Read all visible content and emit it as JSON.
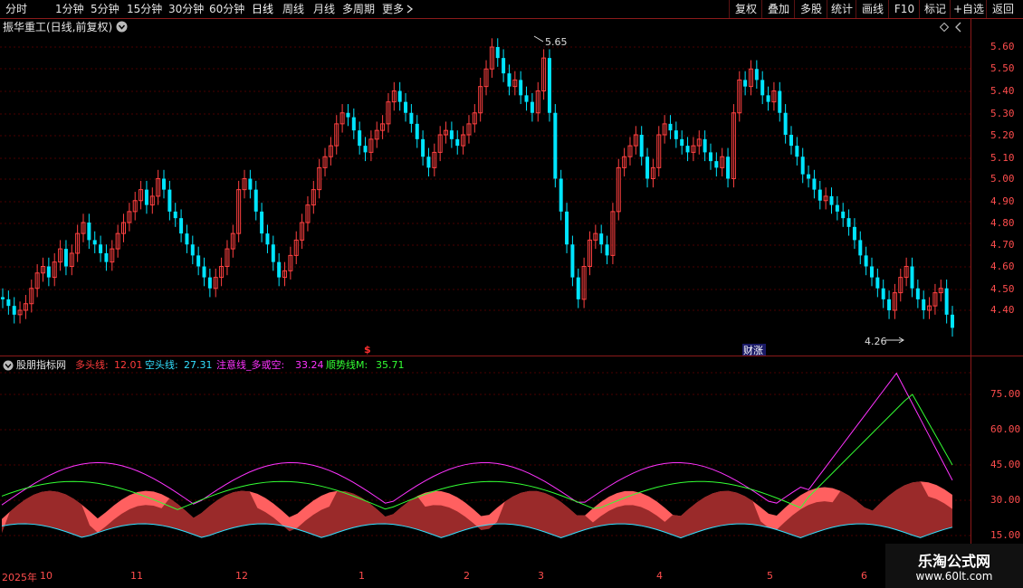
{
  "toolbar": {
    "periods": [
      "分时",
      "1分钟",
      "5分钟",
      "15分钟",
      "30分钟",
      "60分钟",
      "日线",
      "周线",
      "月线",
      "多周期",
      "更多"
    ],
    "active_period": "日线",
    "right_buttons": [
      "复权",
      "叠加",
      "多股",
      "统计",
      "画线",
      "F10",
      "标记",
      "+自选",
      "返回"
    ]
  },
  "title": {
    "text": "振华重工(日线,前复权)",
    "dropdown_icon": "chevron-down-icon",
    "right_icon": "diamond-icon"
  },
  "price_axis": [
    "5.60",
    "5.50",
    "5.40",
    "5.30",
    "5.20",
    "5.10",
    "5.00",
    "4.90",
    "4.80",
    "4.70",
    "4.60",
    "4.50",
    "4.40"
  ],
  "price_annotations": {
    "high": "5.65",
    "low": "4.26",
    "dollar_marker": "$",
    "event_badge": "财涨"
  },
  "indicator": {
    "name": "股朋指标网",
    "lines": [
      {
        "label": "多头线:",
        "value": "12.01",
        "color": "#ff3b3b"
      },
      {
        "label": "空头线:",
        "value": "27.31",
        "color": "#33e0ff"
      },
      {
        "label": "注意线_多或空:",
        "value": "33.24",
        "color": "#ff33ff"
      },
      {
        "label": "顺势线M:",
        "value": "35.71",
        "color": "#33ff33"
      }
    ],
    "axis": [
      "75.00",
      "60.00",
      "45.00",
      "30.00",
      "15.00"
    ]
  },
  "dates": [
    "2025年",
    "10",
    "11",
    "12",
    "1",
    "2",
    "3",
    "4",
    "5",
    "6"
  ],
  "watermark": {
    "line1": "乐淘公式网",
    "line2": "www.60lt.com"
  },
  "colors": {
    "up": "#ff4040",
    "down": "#00e5ff",
    "grid": "#5a0000"
  }
}
